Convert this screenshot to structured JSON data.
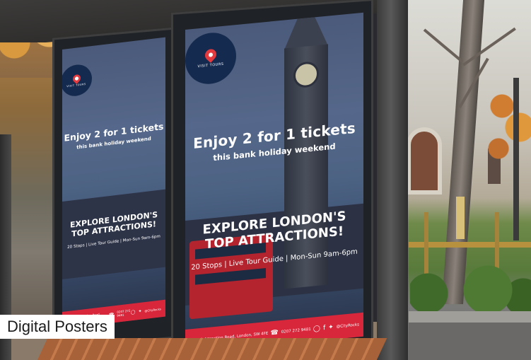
{
  "caption": "Digital Posters",
  "poster": {
    "logo_text": "VISIT TOURS",
    "headline": "Enjoy 2 for 1 tickets",
    "subline": "this bank holiday weekend",
    "explore_line1": "EXPLORE LONDON'S",
    "explore_line2": "TOP ATTRACTIONS!",
    "details": "20 Stops | Live Tour Guide | Mon-Sun 9am-6pm",
    "footer_address": "08 Attraction Road, London, SW 4FE",
    "footer_phone": "0207 272 9481",
    "footer_handle": "@CityRocks",
    "icons": [
      "location-pin-icon",
      "phone-icon",
      "instagram-icon",
      "facebook-icon",
      "twitter-icon"
    ]
  },
  "colors": {
    "brand_red": "#d8263a",
    "brand_navy": "#152a4f"
  }
}
